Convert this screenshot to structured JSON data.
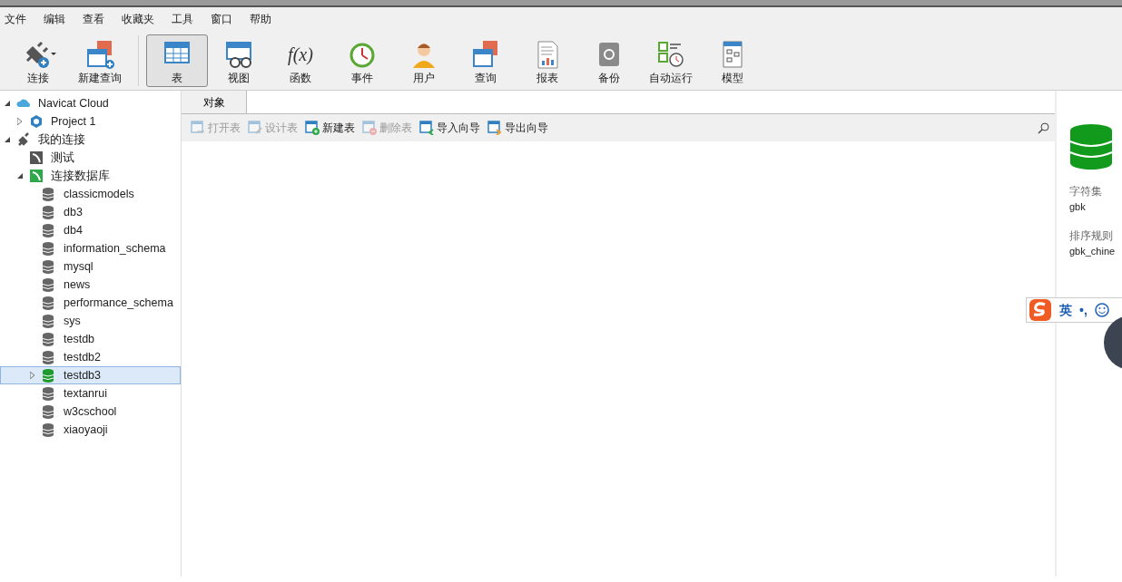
{
  "menu": [
    "文件",
    "编辑",
    "查看",
    "收藏夹",
    "工具",
    "窗口",
    "帮助"
  ],
  "toolbar": [
    {
      "label": "连接",
      "kind": "plug",
      "dropdown": true,
      "selected": false
    },
    {
      "label": "新建查询",
      "kind": "newquery",
      "selected": false
    },
    {
      "label": "表",
      "kind": "table",
      "selected": true
    },
    {
      "label": "视图",
      "kind": "view",
      "selected": false
    },
    {
      "label": "函数",
      "kind": "func",
      "icon_text": "f(x)",
      "selected": false
    },
    {
      "label": "事件",
      "kind": "clock",
      "selected": false
    },
    {
      "label": "用户",
      "kind": "user",
      "selected": false
    },
    {
      "label": "查询",
      "kind": "query",
      "selected": false
    },
    {
      "label": "报表",
      "kind": "report",
      "selected": false
    },
    {
      "label": "备份",
      "kind": "backup",
      "selected": false
    },
    {
      "label": "自动运行",
      "kind": "auto",
      "selected": false
    },
    {
      "label": "模型",
      "kind": "model",
      "selected": false
    }
  ],
  "tree": [
    {
      "label": "Navicat Cloud",
      "kind": "cloud",
      "expanded": true,
      "selected": false,
      "children": [
        {
          "label": "Project 1",
          "kind": "project",
          "expanded": false,
          "selected": false
        }
      ]
    },
    {
      "label": "我的连接",
      "kind": "plug",
      "expanded": true,
      "selected": false,
      "children": [
        {
          "label": "测试",
          "kind": "server",
          "selected": false
        },
        {
          "label": "连接数据库",
          "kind": "server-open",
          "expanded": true,
          "selected": false,
          "children": [
            {
              "label": "classicmodels",
              "kind": "db",
              "selected": false
            },
            {
              "label": "db3",
              "kind": "db",
              "selected": false
            },
            {
              "label": "db4",
              "kind": "db",
              "selected": false
            },
            {
              "label": "information_schema",
              "kind": "db",
              "selected": false
            },
            {
              "label": "mysql",
              "kind": "db",
              "selected": false
            },
            {
              "label": "news",
              "kind": "db",
              "selected": false
            },
            {
              "label": "performance_schema",
              "kind": "db",
              "selected": false
            },
            {
              "label": "sys",
              "kind": "db",
              "selected": false
            },
            {
              "label": "testdb",
              "kind": "db",
              "selected": false
            },
            {
              "label": "testdb2",
              "kind": "db",
              "selected": false
            },
            {
              "label": "testdb3",
              "kind": "db-open",
              "expanded": false,
              "selected": true
            },
            {
              "label": "textanrui",
              "kind": "db",
              "selected": false
            },
            {
              "label": "w3cschool",
              "kind": "db",
              "selected": false
            },
            {
              "label": "xiaoyaoji",
              "kind": "db",
              "selected": false
            }
          ]
        }
      ]
    }
  ],
  "tabs": [
    {
      "label": "对象",
      "selected": true
    }
  ],
  "object_actions": [
    {
      "label": "打开表",
      "kind": "open",
      "disabled": true
    },
    {
      "label": "设计表",
      "kind": "design",
      "disabled": true
    },
    {
      "label": "新建表",
      "kind": "new",
      "disabled": false
    },
    {
      "label": "删除表",
      "kind": "delete",
      "disabled": true
    },
    {
      "label": "导入向导",
      "kind": "import",
      "disabled": false
    },
    {
      "label": "导出向导",
      "kind": "export",
      "disabled": false
    }
  ],
  "info_panel": {
    "fields": [
      {
        "label": "字符集",
        "value": "gbk"
      },
      {
        "label": "排序规则",
        "value": "gbk_chine"
      }
    ]
  },
  "ime_bar": {
    "mode": "英",
    "punct": "•,"
  }
}
